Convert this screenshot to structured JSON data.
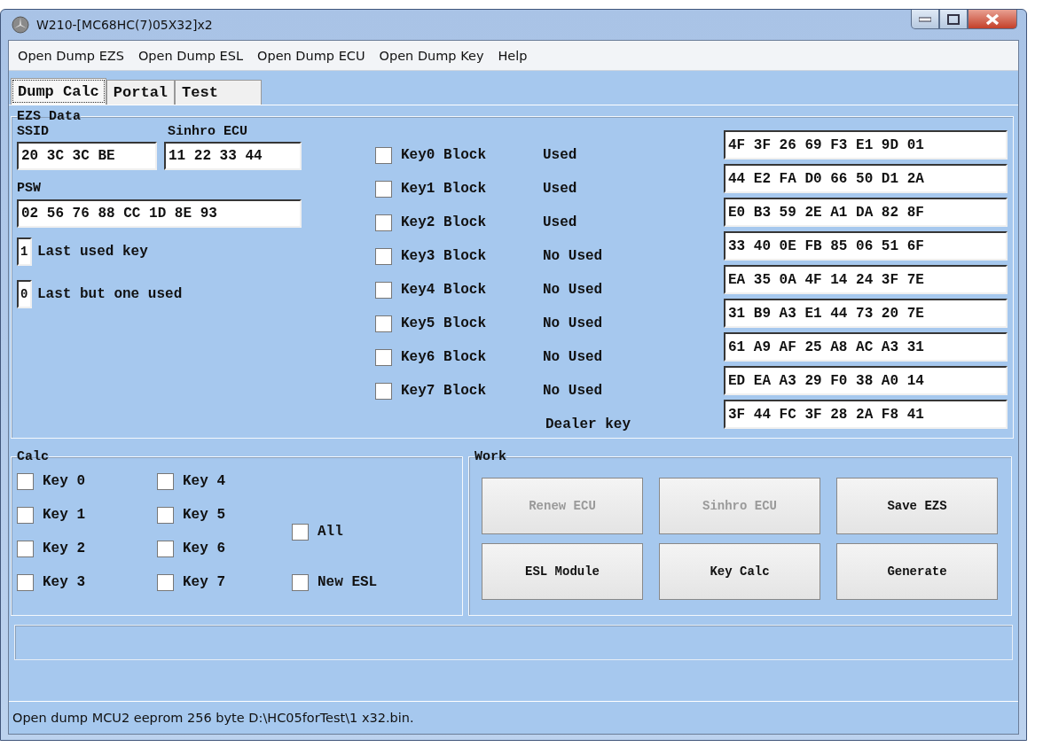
{
  "window": {
    "title": "W210-[MC68HC(7)05X32]x2"
  },
  "menu": [
    "Open Dump EZS",
    "Open Dump ESL",
    "Open Dump ECU",
    "Open Dump Key",
    "Help"
  ],
  "tabs": [
    {
      "label": "Dump Calc",
      "selected": true
    },
    {
      "label": "Portal",
      "selected": false
    },
    {
      "label": "Test",
      "selected": false
    }
  ],
  "ezs_data": {
    "title": "EZS Data",
    "ssid": {
      "label": "SSID",
      "value": "20 3C 3C BE"
    },
    "sinhro_ecu": {
      "label": "Sinhro ECU",
      "value": "11 22 33 44"
    },
    "psw": {
      "label": "PSW",
      "value": "02 56 76 88 CC 1D 8E 93"
    },
    "last_used_key": {
      "value": "1",
      "label": "Last used key"
    },
    "last_but_one": {
      "value": "0",
      "label": "Last but one used"
    },
    "key_blocks": [
      {
        "label": "Key0 Block",
        "status": "Used",
        "checked": false
      },
      {
        "label": "Key1 Block",
        "status": "Used",
        "checked": false
      },
      {
        "label": "Key2 Block",
        "status": "Used",
        "checked": false
      },
      {
        "label": "Key3 Block",
        "status": "No Used",
        "checked": false
      },
      {
        "label": "Key4 Block",
        "status": "No Used",
        "checked": false
      },
      {
        "label": "Key5 Block",
        "status": "No Used",
        "checked": false
      },
      {
        "label": "Key6 Block",
        "status": "No Used",
        "checked": false
      },
      {
        "label": "Key7 Block",
        "status": "No Used",
        "checked": false
      }
    ],
    "dealer_label": "Dealer key",
    "hex_rows": [
      "4F 3F 26 69 F3 E1 9D 01",
      "44 E2 FA D0 66 50 D1 2A",
      "E0 B3 59 2E A1 DA 82 8F",
      "33 40 0E FB 85 06 51 6F",
      "EA 35 0A 4F 14 24 3F 7E",
      "31 B9 A3 E1 44 73 20 7E",
      "61 A9 AF 25 A8 AC A3 31",
      "ED EA A3 29 F0 38 A0 14",
      "3F 44 FC 3F 28 2A F8 41"
    ]
  },
  "calc": {
    "title": "Calc",
    "keys": [
      {
        "label": "Key 0",
        "checked": false
      },
      {
        "label": "Key 1",
        "checked": false
      },
      {
        "label": "Key 2",
        "checked": false
      },
      {
        "label": "Key 3",
        "checked": false
      },
      {
        "label": "Key 4",
        "checked": false
      },
      {
        "label": "Key 5",
        "checked": false
      },
      {
        "label": "Key 6",
        "checked": false
      },
      {
        "label": "Key 7",
        "checked": false
      }
    ],
    "all": {
      "label": "All",
      "checked": false
    },
    "new_esl": {
      "label": "New ESL",
      "checked": false
    }
  },
  "work": {
    "title": "Work",
    "buttons": [
      {
        "label": "Renew ECU",
        "disabled": true
      },
      {
        "label": "Sinhro ECU",
        "disabled": true
      },
      {
        "label": "Save EZS",
        "disabled": false
      },
      {
        "label": "ESL Module",
        "disabled": false
      },
      {
        "label": "Key Calc",
        "disabled": false
      },
      {
        "label": "Generate",
        "disabled": false
      }
    ]
  },
  "status_bar": "Open dump MCU2 eeprom 256 byte D:\\HC05forTest\\1 x32.bin."
}
